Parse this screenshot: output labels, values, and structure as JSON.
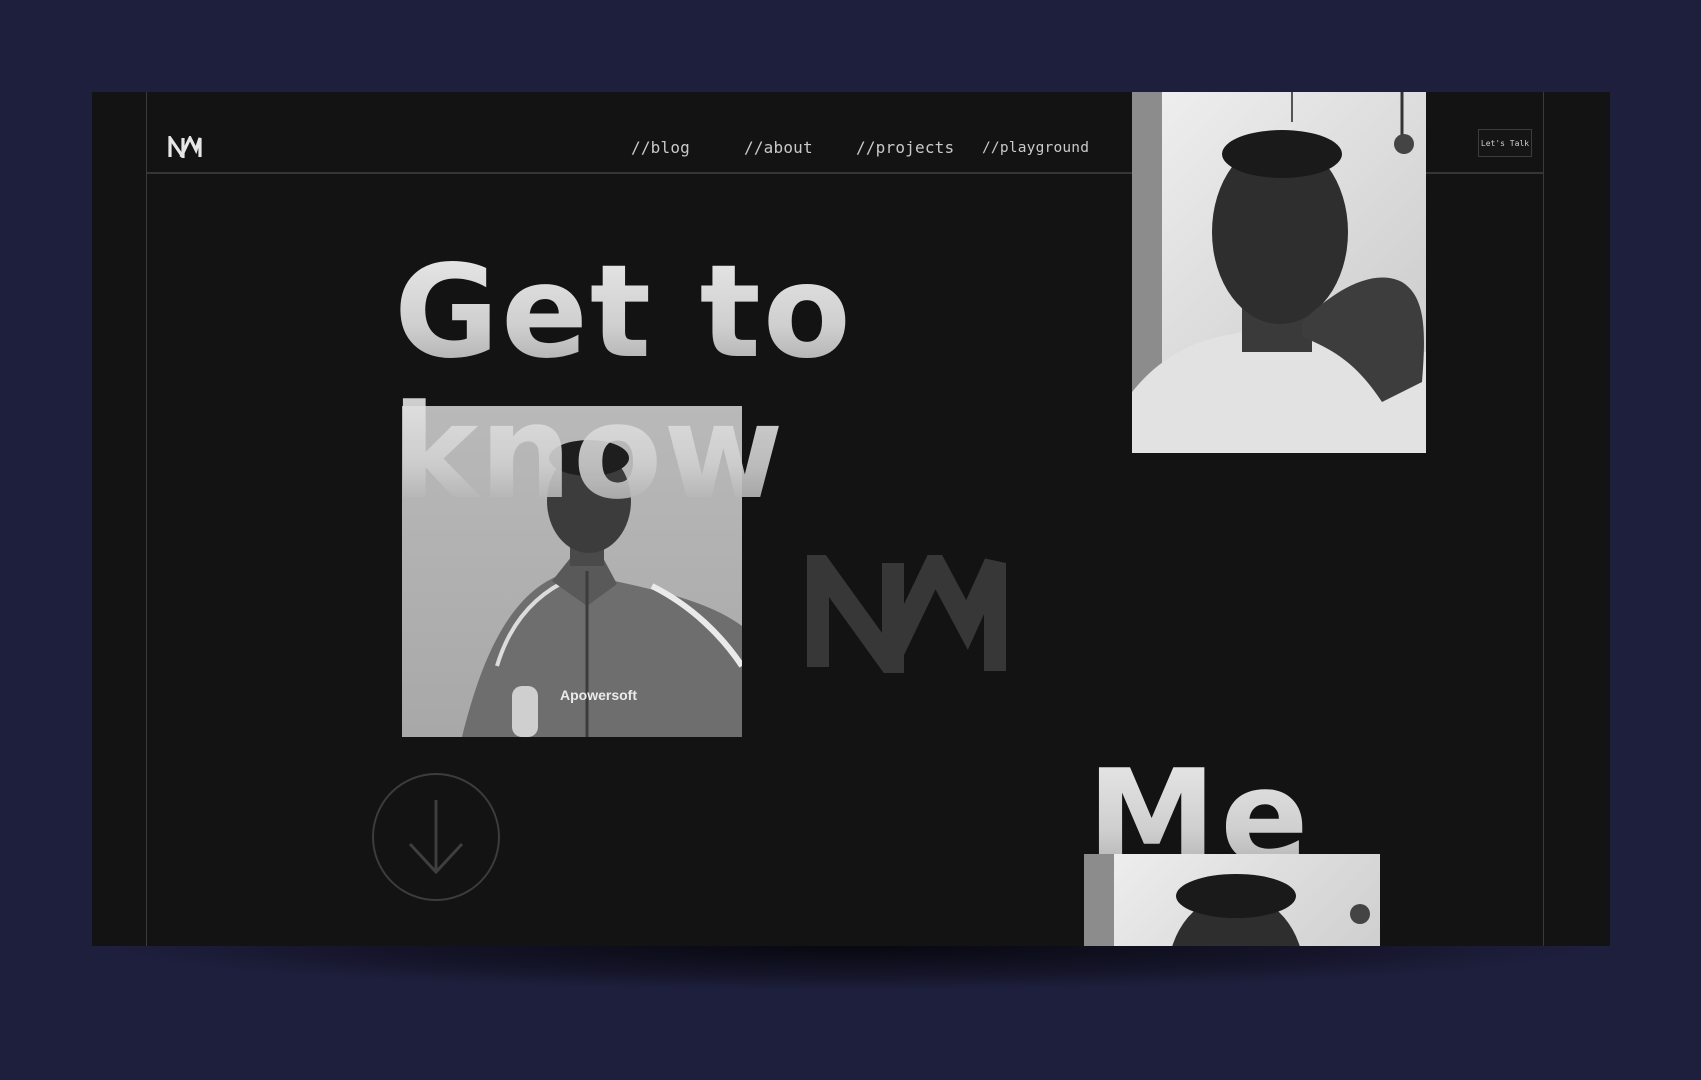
{
  "brand": {
    "logo_icon": "nm-monogram-icon"
  },
  "nav": {
    "blog": "//blog",
    "about": "//about",
    "projects": "//projects",
    "playground": "//playground"
  },
  "cta": {
    "label": "Let's Talk"
  },
  "hero": {
    "line1": "Get to",
    "line2": "know",
    "line3": "Me"
  },
  "photos": {
    "main_watermark": "Apowersoft"
  },
  "icons": {
    "scroll": "arrow-down-circle-icon",
    "monogram": "nm-monogram-icon"
  },
  "colors": {
    "background": "#1e1f3d",
    "panel": "#131313",
    "text": "#e0e0e0"
  }
}
